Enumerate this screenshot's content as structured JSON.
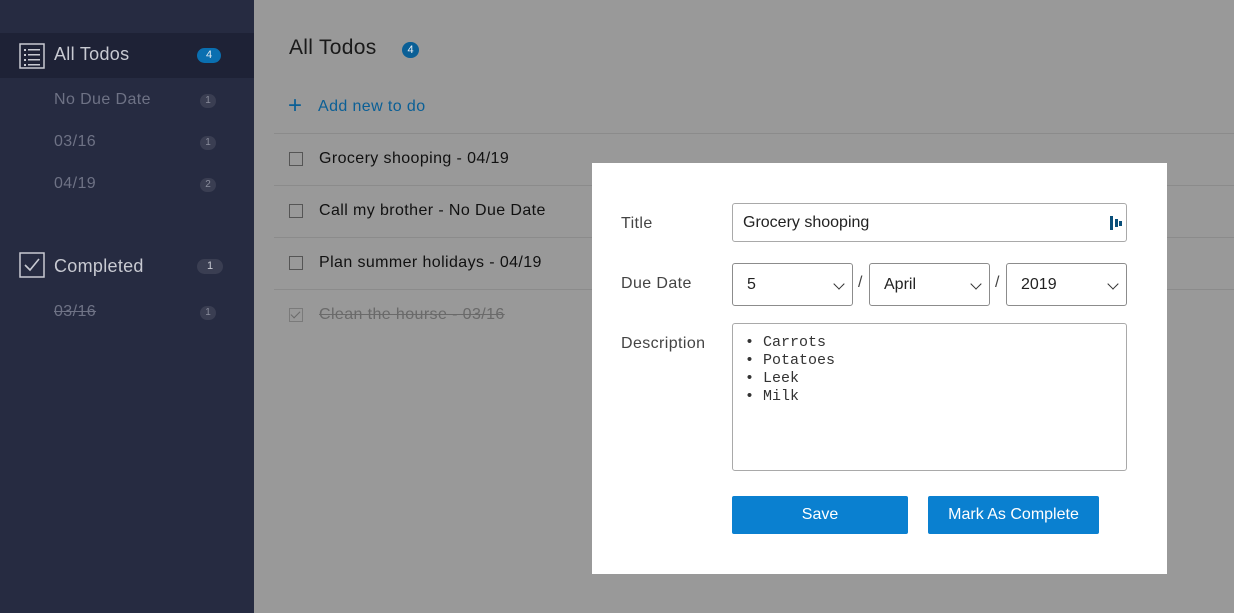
{
  "sidebar": {
    "all_todos": {
      "label": "All Todos",
      "count": "4"
    },
    "all_todos_items": [
      {
        "label": "No Due Date",
        "count": "1"
      },
      {
        "label": "03/16",
        "count": "1"
      },
      {
        "label": "04/19",
        "count": "2"
      }
    ],
    "completed": {
      "label": "Completed",
      "count": "1"
    },
    "completed_items": [
      {
        "label": "03/16",
        "count": "1"
      }
    ]
  },
  "main": {
    "title": "All Todos",
    "count": "4",
    "add_label": "Add new to do",
    "add_icon": "+",
    "todos": [
      {
        "text": "Grocery shooping - 04/19",
        "completed": false
      },
      {
        "text": "Call my brother - No Due Date",
        "completed": false
      },
      {
        "text": "Plan summer holidays - 04/19",
        "completed": false
      },
      {
        "text": "Clean the hourse - 03/16",
        "completed": true
      }
    ]
  },
  "modal": {
    "title_label": "Title",
    "title_value": "Grocery shooping",
    "due_date_label": "Due Date",
    "day": "5",
    "month": "April",
    "year": "2019",
    "date_separator": "/",
    "description_label": "Description",
    "description_lines": [
      "• Carrots",
      "• Potatoes",
      "• Leek",
      "• Milk"
    ],
    "save_label": "Save",
    "complete_label": "Mark As Complete"
  },
  "colors": {
    "sidebar_bg": "#262b41",
    "accent": "#0a80d0",
    "overlay": "#999999"
  }
}
